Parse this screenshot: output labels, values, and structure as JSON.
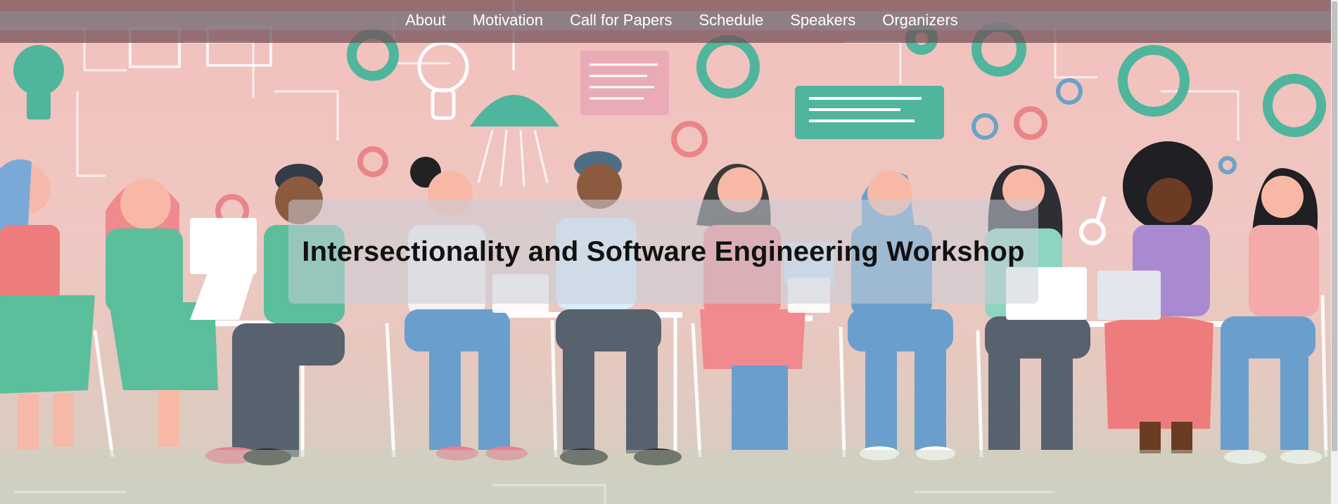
{
  "nav": {
    "items": [
      {
        "label": "About"
      },
      {
        "label": "Motivation"
      },
      {
        "label": "Call for Papers"
      },
      {
        "label": "Schedule"
      },
      {
        "label": "Speakers"
      },
      {
        "label": "Organizers"
      }
    ]
  },
  "hero": {
    "title": "Intersectionality and Software Engineering Workshop"
  },
  "colors": {
    "nav_bar": "#704e56",
    "nav_text": "#ffffff",
    "background_pink": "#f2c0bc",
    "accent_teal": "#4fb59c",
    "title_text": "#111111"
  },
  "icons": [
    "gear-icon",
    "lightbulb-icon",
    "lamp-icon",
    "code-panel-icon",
    "laptop-icon",
    "key-icon"
  ]
}
